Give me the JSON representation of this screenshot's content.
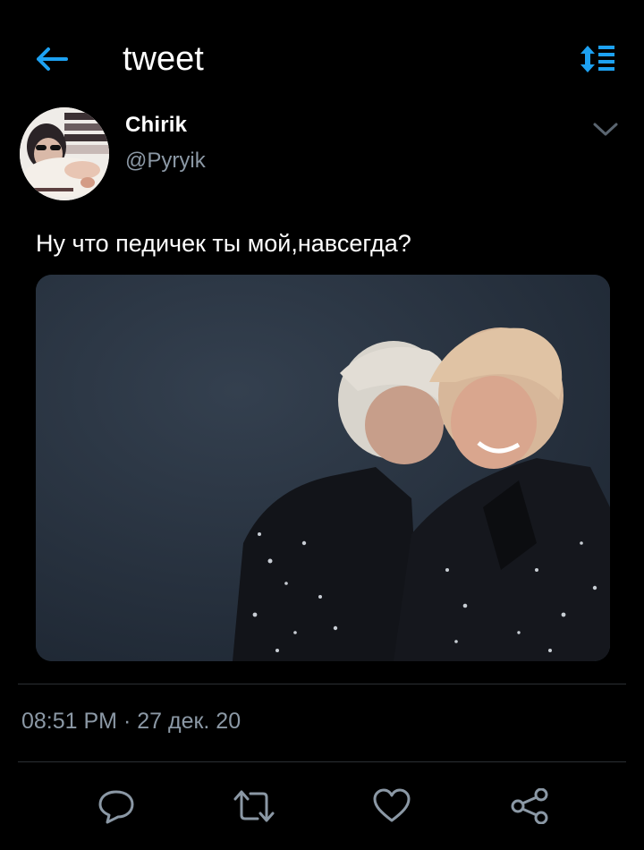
{
  "header": {
    "title": "tweet",
    "back_icon": "arrow-left-icon",
    "sort_icon": "sort-list-icon"
  },
  "tweet": {
    "author_name": "Chirik",
    "author_handle": "@Pyryik",
    "text": "Ну что педичек ты мой,навсегда?",
    "timestamp": "08:51 PM · 27 дек. 20"
  },
  "actions": [
    {
      "icon": "reply-icon"
    },
    {
      "icon": "retweet-icon"
    },
    {
      "icon": "like-icon"
    },
    {
      "icon": "share-icon"
    }
  ],
  "colors": {
    "accent": "#1da1f2",
    "background": "#000000",
    "secondary_text": "#8b98a5",
    "divider": "#2b2f33"
  }
}
